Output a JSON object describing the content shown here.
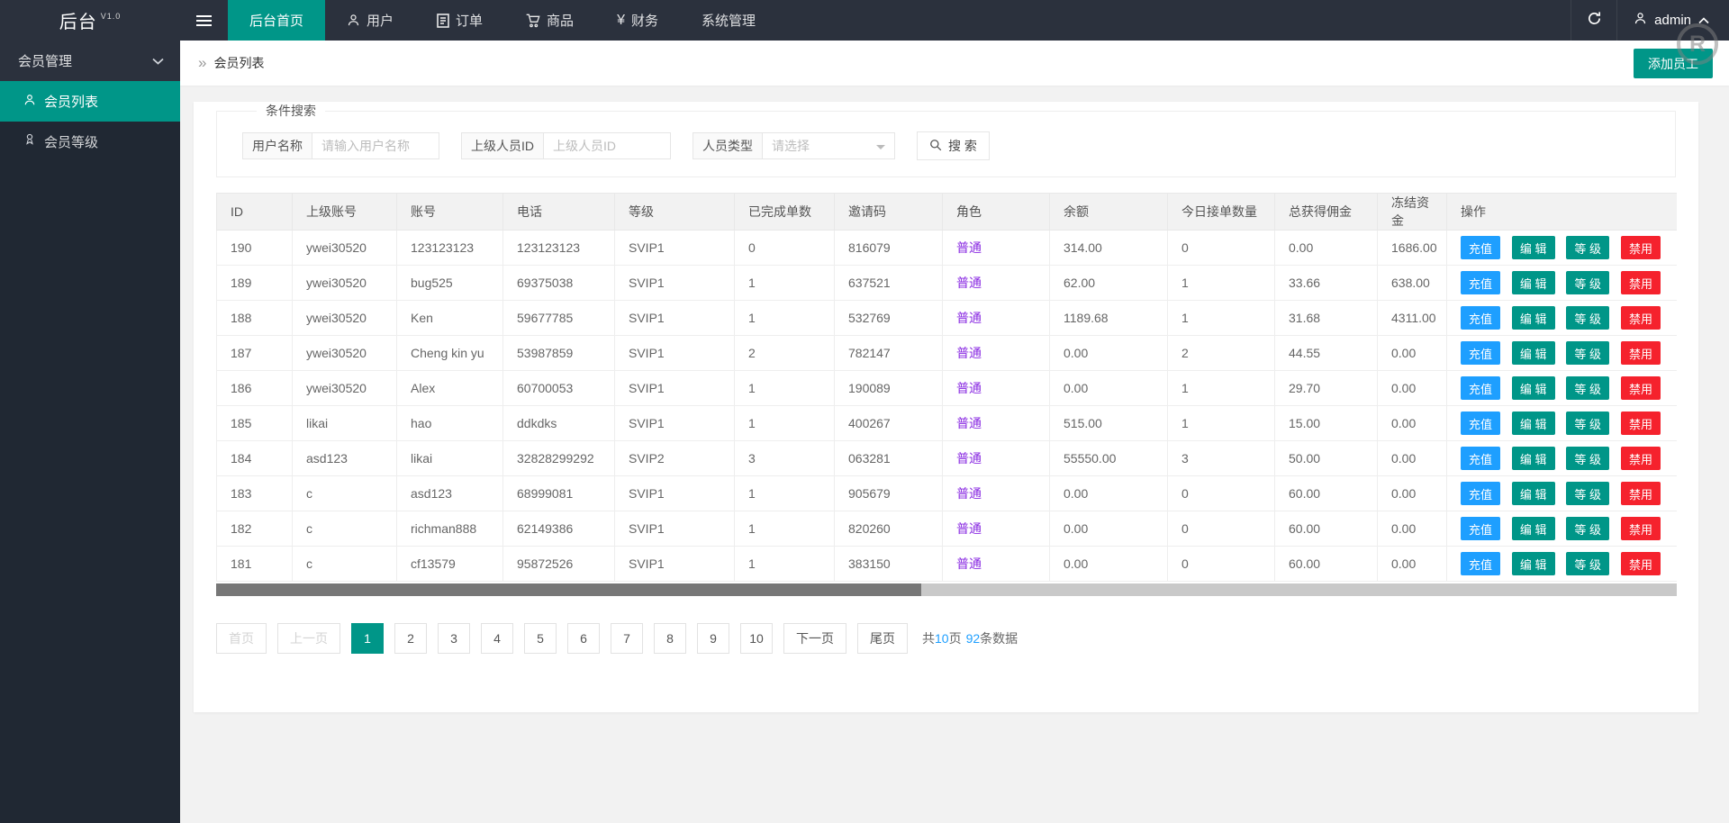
{
  "colors": {
    "teal": "#009688",
    "blue": "#1E9FFF",
    "red": "#F5222D",
    "purple": "#8A2BE2",
    "header_bg": "#2B313D",
    "sidebar_bg": "#202833"
  },
  "icons": {
    "breadcrumb": "»",
    "yen": "¥",
    "watermark": "R"
  },
  "header": {
    "logo": "后台",
    "version": "V1.0",
    "nav": [
      {
        "label": "后台首页",
        "active": true
      },
      {
        "label": "用户"
      },
      {
        "label": "订单"
      },
      {
        "label": "商品"
      },
      {
        "label": "财务"
      },
      {
        "label": "系统管理"
      }
    ],
    "username": "admin"
  },
  "sidebar": {
    "group": "会员管理",
    "items": [
      {
        "label": "会员列表",
        "active": true
      },
      {
        "label": "会员等级"
      }
    ]
  },
  "breadcrumb": {
    "title": "会员列表",
    "add_button": "添加员工"
  },
  "search": {
    "legend": "条件搜索",
    "fields": [
      {
        "label": "用户名称",
        "placeholder": "请输入用户名称"
      },
      {
        "label": "上级人员ID",
        "placeholder": "上级人员ID"
      },
      {
        "label": "人员类型",
        "placeholder": "请选择"
      }
    ],
    "button": "搜 索"
  },
  "table": {
    "columns": [
      "ID",
      "上级账号",
      "账号",
      "电话",
      "等级",
      "已完成单数",
      "邀请码",
      "角色",
      "余额",
      "今日接单数量",
      "总获得佣金",
      "冻结资金",
      "操作"
    ],
    "actions": [
      "充值",
      "编 辑",
      "等 级",
      "禁用"
    ],
    "rows": [
      {
        "id": "190",
        "parent": "ywei30520",
        "account": "123123123",
        "phone": "123123123",
        "level": "SVIP1",
        "done": "0",
        "invite": "816079",
        "role": "普通",
        "balance": "314.00",
        "today": "0",
        "commission": "0.00",
        "frozen": "1686.00"
      },
      {
        "id": "189",
        "parent": "ywei30520",
        "account": "bug525",
        "phone": "69375038",
        "level": "SVIP1",
        "done": "1",
        "invite": "637521",
        "role": "普通",
        "balance": "62.00",
        "today": "1",
        "commission": "33.66",
        "frozen": "638.00"
      },
      {
        "id": "188",
        "parent": "ywei30520",
        "account": "Ken",
        "phone": "59677785",
        "level": "SVIP1",
        "done": "1",
        "invite": "532769",
        "role": "普通",
        "balance": "1189.68",
        "today": "1",
        "commission": "31.68",
        "frozen": "4311.00"
      },
      {
        "id": "187",
        "parent": "ywei30520",
        "account": "Cheng kin yu",
        "phone": "53987859",
        "level": "SVIP1",
        "done": "2",
        "invite": "782147",
        "role": "普通",
        "balance": "0.00",
        "today": "2",
        "commission": "44.55",
        "frozen": "0.00"
      },
      {
        "id": "186",
        "parent": "ywei30520",
        "account": "Alex",
        "phone": "60700053",
        "level": "SVIP1",
        "done": "1",
        "invite": "190089",
        "role": "普通",
        "balance": "0.00",
        "today": "1",
        "commission": "29.70",
        "frozen": "0.00"
      },
      {
        "id": "185",
        "parent": "likai",
        "account": "hao",
        "phone": "ddkdks",
        "level": "SVIP1",
        "done": "1",
        "invite": "400267",
        "role": "普通",
        "balance": "515.00",
        "today": "1",
        "commission": "15.00",
        "frozen": "0.00"
      },
      {
        "id": "184",
        "parent": "asd123",
        "account": "likai",
        "phone": "32828299292",
        "level": "SVIP2",
        "done": "3",
        "invite": "063281",
        "role": "普通",
        "balance": "55550.00",
        "today": "3",
        "commission": "50.00",
        "frozen": "0.00"
      },
      {
        "id": "183",
        "parent": "c",
        "account": "asd123",
        "phone": "68999081",
        "level": "SVIP1",
        "done": "1",
        "invite": "905679",
        "role": "普通",
        "balance": "0.00",
        "today": "0",
        "commission": "60.00",
        "frozen": "0.00"
      },
      {
        "id": "182",
        "parent": "c",
        "account": "richman888",
        "phone": "62149386",
        "level": "SVIP1",
        "done": "1",
        "invite": "820260",
        "role": "普通",
        "balance": "0.00",
        "today": "0",
        "commission": "60.00",
        "frozen": "0.00"
      },
      {
        "id": "181",
        "parent": "c",
        "account": "cf13579",
        "phone": "95872526",
        "level": "SVIP1",
        "done": "1",
        "invite": "383150",
        "role": "普通",
        "balance": "0.00",
        "today": "0",
        "commission": "60.00",
        "frozen": "0.00"
      }
    ]
  },
  "pagination": {
    "first": "首页",
    "prev": "上一页",
    "pages": [
      {
        "label": "1",
        "active": true
      },
      {
        "label": "2"
      },
      {
        "label": "3"
      },
      {
        "label": "4"
      },
      {
        "label": "5"
      },
      {
        "label": "6"
      },
      {
        "label": "7"
      },
      {
        "label": "8"
      },
      {
        "label": "9"
      },
      {
        "label": "10"
      }
    ],
    "next": "下一页",
    "last": "尾页",
    "summary": {
      "t1": "共",
      "total_pages": "10",
      "t2": "页",
      "total_count": "92",
      "t3": "条数据"
    }
  }
}
